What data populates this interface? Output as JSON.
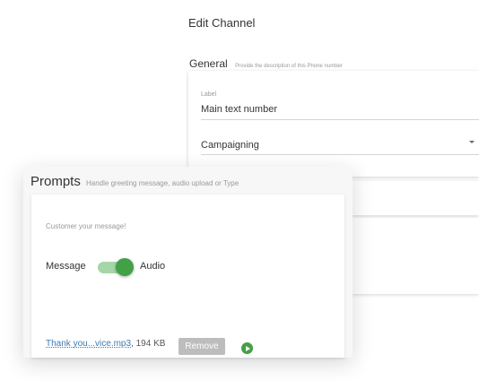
{
  "edit_channel": {
    "title": "Edit Channel",
    "general": {
      "title": "General",
      "description": "Provide the description of this Phone number",
      "label_field": {
        "label": "Label",
        "value": "Main text number"
      },
      "type_select": {
        "value": "Campaigning",
        "icon": "caret-down-icon"
      }
    }
  },
  "prompts": {
    "title": "Prompts",
    "description": "Handle greeting message, audio upload or Type",
    "customer_message": "Customer your message!",
    "toggle": {
      "left_label": "Message",
      "right_label": "Audio",
      "state": "audio",
      "accent_color": "#43a047"
    },
    "file": {
      "name": "Thank you...vice.mp3",
      "size": ", 194 KB",
      "remove_label": "Remove",
      "play_icon": "play-icon"
    }
  }
}
